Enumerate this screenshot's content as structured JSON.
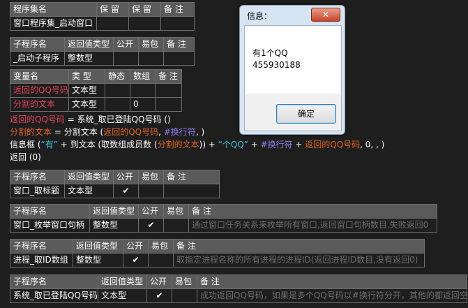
{
  "assembly_table": {
    "headers": [
      "程序集名",
      "保 留",
      "保 留",
      "备 注"
    ],
    "row": [
      "窗口程序集_启动窗口",
      "",
      "",
      ""
    ]
  },
  "start_sub_table": {
    "headers": [
      "子程序名",
      "返回值类型",
      "公开",
      "易包",
      "备 注"
    ],
    "row": [
      "_启动子程序",
      "整数型",
      "",
      "",
      ""
    ]
  },
  "vars_table": {
    "headers": [
      "变量名",
      "类 型",
      "静态",
      "数组",
      "备 注"
    ],
    "rows": [
      [
        "返回的QQ号码",
        "文本型",
        "",
        "",
        ""
      ],
      [
        "分割的文本",
        "文本型",
        "",
        "0",
        ""
      ]
    ]
  },
  "code": {
    "line1": {
      "a": "返回的QQ号码",
      "b": " = 系统_取已登陆QQ号码 ()"
    },
    "line2": {
      "a": "分割的文本",
      "b": " = 分割文本 (",
      "c": "返回的QQ号码",
      "d": ", ",
      "e": "#换行符",
      "f": ", )"
    },
    "line3": {
      "a": "信息框 (",
      "b": "“有”",
      "c": " + 到文本 (取数组成员数 (",
      "d": "分割的文本",
      "e": ")) + ",
      "f": "“个QQ”",
      "g": " + ",
      "h": "#换行符",
      "i": " + ",
      "j": "返回的QQ号码",
      "k": ", 0, , )"
    },
    "line4": "返回 (0)"
  },
  "sub_tables": [
    {
      "headers": [
        "子程序名",
        "返回值类型",
        "公开",
        "易包",
        "备 注"
      ],
      "name": "窗口_取标题",
      "type": "文本型",
      "public": "✔",
      "note": ""
    },
    {
      "headers": [
        "子程序名",
        "返回值类型",
        "公开",
        "易包",
        "备 注"
      ],
      "name": "窗口_枚举窗口句柄",
      "type": "整数型",
      "public": "✔",
      "note": "通过窗口任务关系来枚举所有窗口,返回窗口句柄数目,失败返回0"
    },
    {
      "headers": [
        "子程序名",
        "返回值类型",
        "公开",
        "易包",
        "备 注"
      ],
      "name": "进程_取ID数组",
      "type": "整数型",
      "public": "✔",
      "note": "取指定进程名称的所有进程的进程ID(返回进程ID数目,没有返回0)"
    },
    {
      "headers": [
        "子程序名",
        "返回值类型",
        "公开",
        "易包",
        "备 注"
      ],
      "name": "系统_取已登陆QQ号码",
      "type": "文本型",
      "public": "✔",
      "note": "成功返回QQ号码，如果是多个QQ号码以#换行符分开，其他的都返回空"
    }
  ],
  "dialog": {
    "title": "信息：",
    "close": "✕",
    "line1": "有1个QQ",
    "line2": "455930188",
    "ok": "确定"
  }
}
